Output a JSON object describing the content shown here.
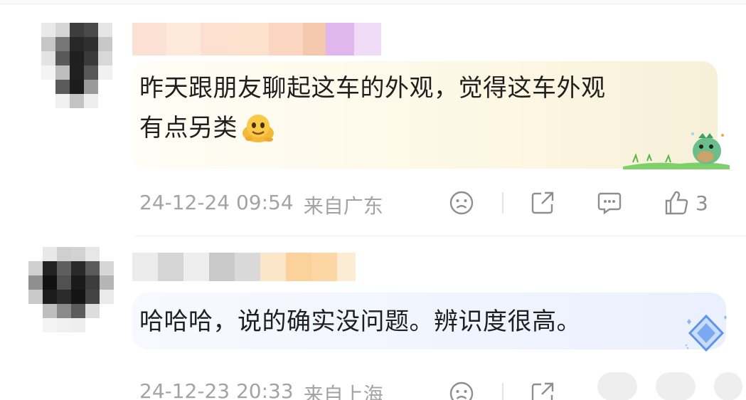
{
  "comments": [
    {
      "text_line1": "昨天跟朋友聊起这车的外观，觉得这车外观",
      "text_line2": "有点另类",
      "emoji": "melting-face-icon",
      "timestamp": "24-12-24 09:54",
      "location": "来自广东",
      "like_count": "3",
      "bubble_theme": "dinosaur-on-grass"
    },
    {
      "text_line1": "哈哈哈，说的确实没问题。辨识度很高。",
      "timestamp": "24-12-23 20:33",
      "location": "来自上海",
      "bubble_theme": "blue-diamond"
    }
  ],
  "icons": {
    "dislike": "frown-face-icon",
    "share": "share-out-icon",
    "reply": "comment-bubble-icon",
    "like": "thumbs-up-icon"
  },
  "colors": {
    "meta_text": "#a3a3a3",
    "body_text": "#1f1f1f",
    "bubble_warm": "#fdf7e3",
    "bubble_blue": "#eef3fe"
  }
}
